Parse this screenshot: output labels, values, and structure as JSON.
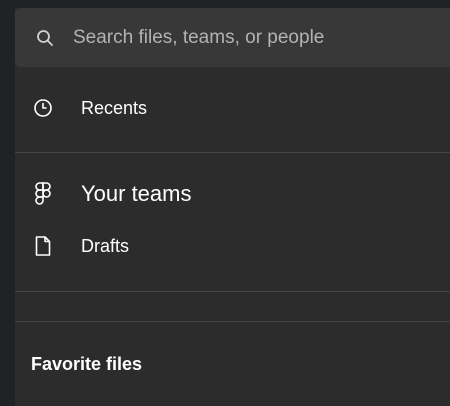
{
  "search": {
    "placeholder": "Search files, teams, or people",
    "icon": "search-icon"
  },
  "nav": {
    "recents": {
      "label": "Recents",
      "icon": "clock-icon"
    },
    "teams": {
      "label": "Your teams",
      "icon": "figma-logo-icon"
    },
    "drafts": {
      "label": "Drafts",
      "icon": "file-icon"
    }
  },
  "sections": {
    "favorites_title": "Favorite files"
  },
  "colors": {
    "background": "#2c2c2c",
    "search_background": "#383838",
    "chrome": "#1f2324",
    "divider": "#444444",
    "text": "#ffffff",
    "muted_text": "#b3b3b3"
  }
}
